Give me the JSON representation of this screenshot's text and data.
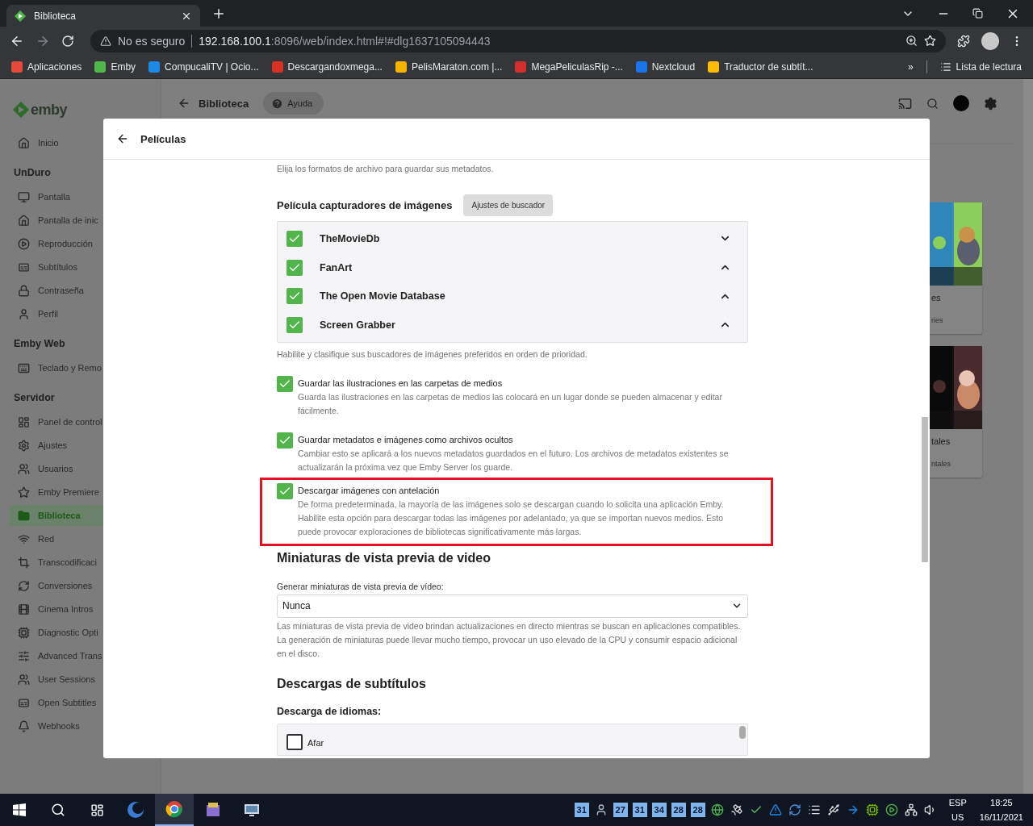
{
  "browser": {
    "tab": {
      "title": "Biblioteca"
    },
    "security": "No es seguro",
    "url_host": "192.168.100.1",
    "url_rest": ":8096/web/index.html#!#dlg1637105094443",
    "bookmarks": [
      {
        "label": "Aplicaciones"
      },
      {
        "label": "Emby"
      },
      {
        "label": "CompucaliTV | Ocio..."
      },
      {
        "label": "Descargandoxmega..."
      },
      {
        "label": "PelisMaraton.com |..."
      },
      {
        "label": "MegaPeliculasRip -..."
      },
      {
        "label": "Nextcloud"
      },
      {
        "label": "Traductor de subtít..."
      }
    ],
    "bookmarks_overflow": "»",
    "reading_list": "Lista de lectura"
  },
  "app": {
    "logo": "emby",
    "sidebar": {
      "top": [
        {
          "label": "Inicio",
          "selected": false
        }
      ],
      "sections": [
        {
          "title": "UnDuro",
          "items": [
            {
              "label": "Pantalla",
              "selected": false
            },
            {
              "label": "Pantalla de inic",
              "selected": false
            },
            {
              "label": "Reproducción",
              "selected": false
            },
            {
              "label": "Subtítulos",
              "selected": false
            },
            {
              "label": "Contraseña",
              "selected": false
            },
            {
              "label": "Perfil",
              "selected": false
            }
          ]
        },
        {
          "title": "Emby Web",
          "items": [
            {
              "label": "Teclado y Remo",
              "selected": false
            }
          ]
        },
        {
          "title": "Servidor",
          "items": [
            {
              "label": "Panel de control",
              "selected": false
            },
            {
              "label": "Ajustes",
              "selected": false
            },
            {
              "label": "Usuarios",
              "selected": false
            },
            {
              "label": "Emby Premiere",
              "selected": false
            },
            {
              "label": "Biblioteca",
              "selected": true
            },
            {
              "label": "Red",
              "selected": false
            },
            {
              "label": "Transcodificaci",
              "selected": false
            },
            {
              "label": "Conversiones",
              "selected": false
            },
            {
              "label": "Cinema Intros",
              "selected": false
            },
            {
              "label": "Diagnostic Opti",
              "selected": false
            },
            {
              "label": "Advanced Trans",
              "selected": false
            },
            {
              "label": "User Sessions",
              "selected": false
            },
            {
              "label": "Open Subtitles",
              "selected": false
            },
            {
              "label": "Webhooks",
              "selected": false
            }
          ]
        }
      ]
    },
    "header": {
      "title": "Biblioteca",
      "help": "Ayuda"
    },
    "cards": [
      {
        "title": "es",
        "subtitle": "ries"
      },
      {
        "title": "tales",
        "subtitle": "ntales"
      }
    ]
  },
  "dialog": {
    "title": "Películas",
    "metadata_hint": "Elija los formatos de archivo para guardar sus metadatos.",
    "fetchers": {
      "title": "Película capturadores de imágenes",
      "settings_button": "Ajustes de buscador",
      "items": [
        {
          "name": "TheMovieDb",
          "checked": true,
          "kind": "down"
        },
        {
          "name": "FanArt",
          "checked": true,
          "kind": "up"
        },
        {
          "name": "The Open Movie Database",
          "checked": true,
          "kind": "up"
        },
        {
          "name": "Screen Grabber",
          "checked": true,
          "kind": "up"
        }
      ],
      "hint": "Habilite y clasifique sus buscadores de imágenes preferidos en orden de prioridad."
    },
    "options": [
      {
        "label": "Guardar las ilustraciones en las carpetas de medios",
        "description": "Guarda las ilustraciones en las carpetas de medios las colocará en un lugar donde se pueden almacenar y editar fácilmente.",
        "checked": true,
        "highlighted": false
      },
      {
        "label": "Guardar metadatos e imágenes como archivos ocultos",
        "description": "Cambiar esto se aplicará a los nuevos metadatos guardados en el futuro. Los archivos de metadatos existentes se actualizarán la próxima vez que Emby Server los guarde.",
        "checked": true,
        "highlighted": false
      },
      {
        "label": "Descargar imágenes con antelación",
        "description": "De forma predeterminada, la mayoría de las imágenes solo se descargan cuando lo solicita una aplicación Emby. Habilite esta opción para descargar todas las imágenes por adelantado, ya que se importan nuevos medios. Esto puede provocar exploraciones de bibliotecas significativamente más largas.",
        "checked": true,
        "highlighted": true
      }
    ],
    "thumbnails": {
      "title": "Miniaturas de vista previa de video",
      "field_label": "Generar miniaturas de vista previa de vídeo:",
      "value": "Nunca",
      "hint": "Las miniaturas de vista previa de video brindan actualizaciones en directo mientras se buscan en aplicaciones compatibles. La generación de miniaturas puede llevar mucho tiempo, provocar un uso elevado de la CPU y consumir espacio adicional en el disco."
    },
    "subtitles": {
      "title": "Descargas de subtítulos",
      "languages_label": "Descarga de idiomas:",
      "languages": [
        {
          "label": "Afar",
          "checked": false
        }
      ]
    }
  },
  "taskbar": {
    "tray": [
      {
        "kind": "number",
        "text": "31"
      },
      {
        "kind": "icon"
      },
      {
        "kind": "number",
        "text": "27"
      },
      {
        "kind": "number",
        "text": "31"
      },
      {
        "kind": "number",
        "text": "34"
      },
      {
        "kind": "number",
        "text": "28"
      },
      {
        "kind": "number",
        "text": "28"
      },
      {
        "kind": "icon"
      },
      {
        "kind": "icon"
      },
      {
        "kind": "icon"
      },
      {
        "kind": "icon"
      },
      {
        "kind": "icon"
      },
      {
        "kind": "icon"
      },
      {
        "kind": "icon"
      },
      {
        "kind": "icon"
      },
      {
        "kind": "icon"
      },
      {
        "kind": "icon"
      },
      {
        "kind": "icon"
      },
      {
        "kind": "icon"
      }
    ],
    "language": "ESP",
    "layout": "US",
    "time": "18:25",
    "date": "16/11/2021"
  }
}
